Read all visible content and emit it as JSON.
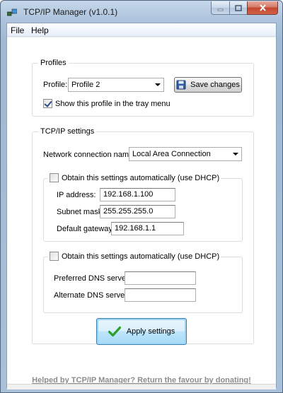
{
  "window": {
    "title": "TCP/IP Manager (v1.0.1)"
  },
  "menu": {
    "file": "File",
    "help": "Help"
  },
  "profiles": {
    "legend": "Profiles",
    "profile_label": "Profile:",
    "profile_value": "Profile 2",
    "save_label": "Save changes",
    "tray_label": "Show this profile in the tray menu",
    "tray_checked": true
  },
  "tcpip": {
    "legend": "TCP/IP settings",
    "connection_label": "Network connection name:",
    "connection_value": "Local Area Connection",
    "ip_group": {
      "dhcp_label": "Obtain this settings automatically (use DHCP)",
      "ip_label": "IP address:",
      "ip_value": "192.168.1.100",
      "mask_label": "Subnet mask:",
      "mask_value": "255.255.255.0",
      "gateway_label": "Default gateway:",
      "gateway_value": "192.168.1.1"
    },
    "dns_group": {
      "dhcp_label": "Obtain this settings automatically (use DHCP)",
      "preferred_label": "Preferred DNS server:",
      "preferred_value": "",
      "alternate_label": "Alternate DNS server:",
      "alternate_value": ""
    }
  },
  "apply_label": "Apply settings",
  "donate_text": "Helped by TCP/IP Manager? Return the favour by donating!",
  "colors": {
    "accent": "#3c7fb1",
    "check_green": "#2e9e2e",
    "link_gray": "#8c8c8c"
  }
}
